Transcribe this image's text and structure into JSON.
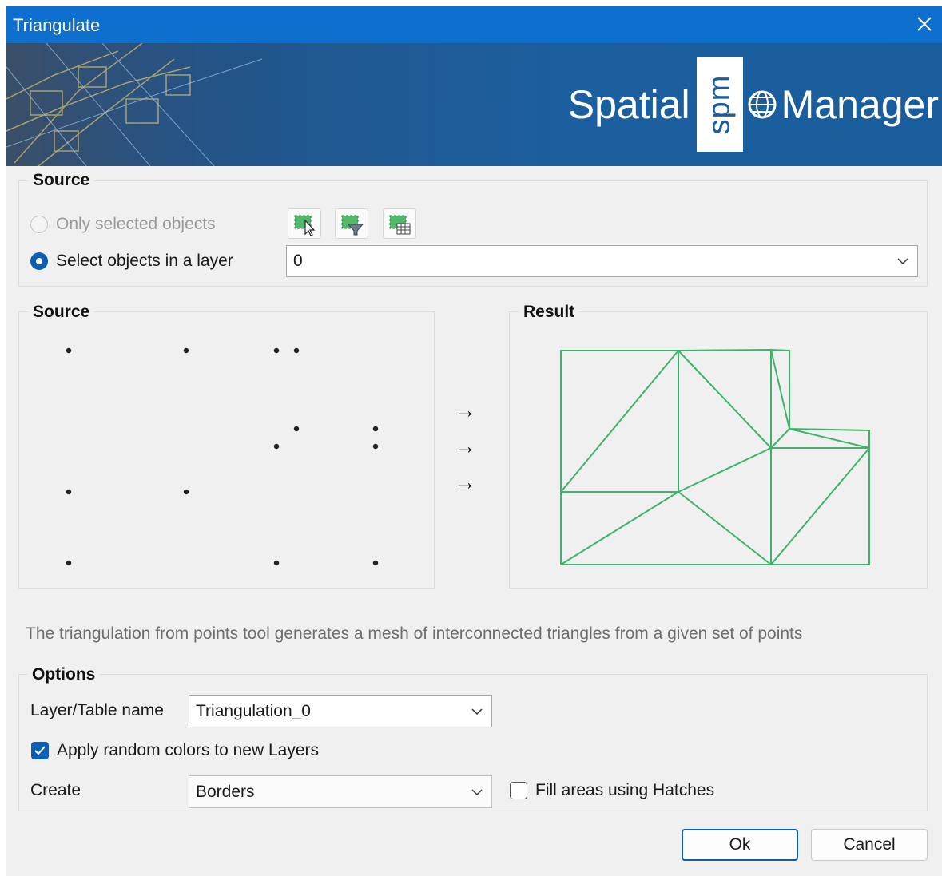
{
  "window": {
    "title": "Triangulate"
  },
  "banner": {
    "brand_left": "Spatial",
    "brand_badge": "spm",
    "brand_right": "Manager"
  },
  "source_group": {
    "label": "Source",
    "radio_selected_objects": "Only selected objects",
    "radio_layer": "Select objects in a layer",
    "layer_value": "0"
  },
  "preview": {
    "source_label": "Source",
    "result_label": "Result",
    "arrows": [
      "→",
      "→",
      "→"
    ]
  },
  "description": "The triangulation from points tool generates a mesh of interconnected triangles from a given set of points",
  "options": {
    "label": "Options",
    "layer_name_label": "Layer/Table name",
    "layer_name_value": "Triangulation_0",
    "apply_colors_label": "Apply random colors to new Layers",
    "apply_colors_checked": true,
    "create_label": "Create",
    "create_value": "Borders",
    "fill_hatches_label": "Fill areas using Hatches",
    "fill_hatches_checked": false
  },
  "buttons": {
    "ok": "Ok",
    "cancel": "Cancel"
  },
  "colors": {
    "title_bar": "#0d6fce",
    "accent": "#0c5fb2",
    "mesh": "#3cb56a"
  }
}
